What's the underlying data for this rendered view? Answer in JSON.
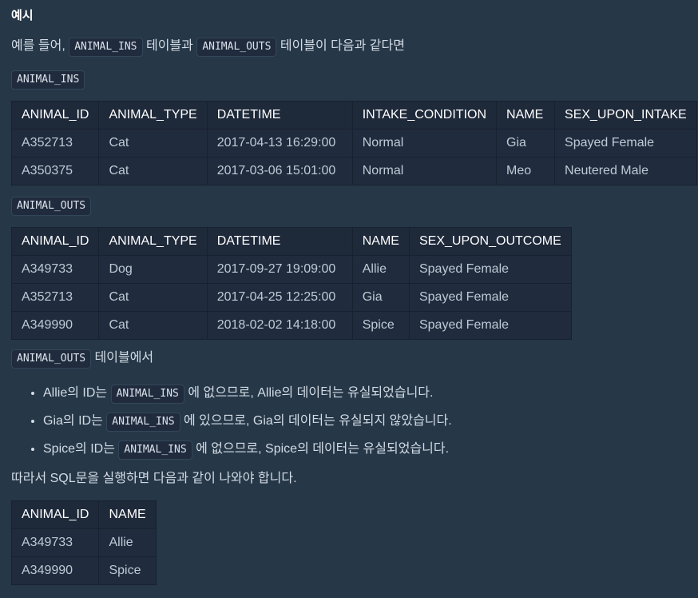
{
  "heading": "예시",
  "intro": {
    "prefix": "예를 들어,",
    "table1": "ANIMAL_INS",
    "middle": "테이블과",
    "table2": "ANIMAL_OUTS",
    "suffix": "테이블이 다음과 같다면"
  },
  "ins_label": "ANIMAL_INS",
  "ins_table": {
    "headers": [
      "ANIMAL_ID",
      "ANIMAL_TYPE",
      "DATETIME",
      "INTAKE_CONDITION",
      "NAME",
      "SEX_UPON_INTAKE"
    ],
    "rows": [
      [
        "A352713",
        "Cat",
        "2017-04-13 16:29:00",
        "Normal",
        "Gia",
        "Spayed Female"
      ],
      [
        "A350375",
        "Cat",
        "2017-03-06 15:01:00",
        "Normal",
        "Meo",
        "Neutered Male"
      ]
    ]
  },
  "outs_label": "ANIMAL_OUTS",
  "outs_table": {
    "headers": [
      "ANIMAL_ID",
      "ANIMAL_TYPE",
      "DATETIME",
      "NAME",
      "SEX_UPON_OUTCOME"
    ],
    "rows": [
      [
        "A349733",
        "Dog",
        "2017-09-27 19:09:00",
        "Allie",
        "Spayed Female"
      ],
      [
        "A352713",
        "Cat",
        "2017-04-25 12:25:00",
        "Gia",
        "Spayed Female"
      ],
      [
        "A349990",
        "Cat",
        "2018-02-02 14:18:00",
        "Spice",
        "Spayed Female"
      ]
    ]
  },
  "outs_note": {
    "code": "ANIMAL_OUTS",
    "text": "테이블에서"
  },
  "bullets": [
    {
      "before": "Allie의 ID는",
      "code": "ANIMAL_INS",
      "after": "에 없으므로, Allie의 데이터는 유실되었습니다."
    },
    {
      "before": "Gia의 ID는",
      "code": "ANIMAL_INS",
      "after": "에 있으므로, Gia의 데이터는 유실되지 않았습니다."
    },
    {
      "before": "Spice의 ID는",
      "code": "ANIMAL_INS",
      "after": "에 없으므로, Spice의 데이터는 유실되었습니다."
    }
  ],
  "conclusion": "따라서 SQL문을 실행하면 다음과 같이 나와야 합니다.",
  "result_table": {
    "headers": [
      "ANIMAL_ID",
      "NAME"
    ],
    "rows": [
      [
        "A349733",
        "Allie"
      ],
      [
        "A349990",
        "Spice"
      ]
    ]
  }
}
